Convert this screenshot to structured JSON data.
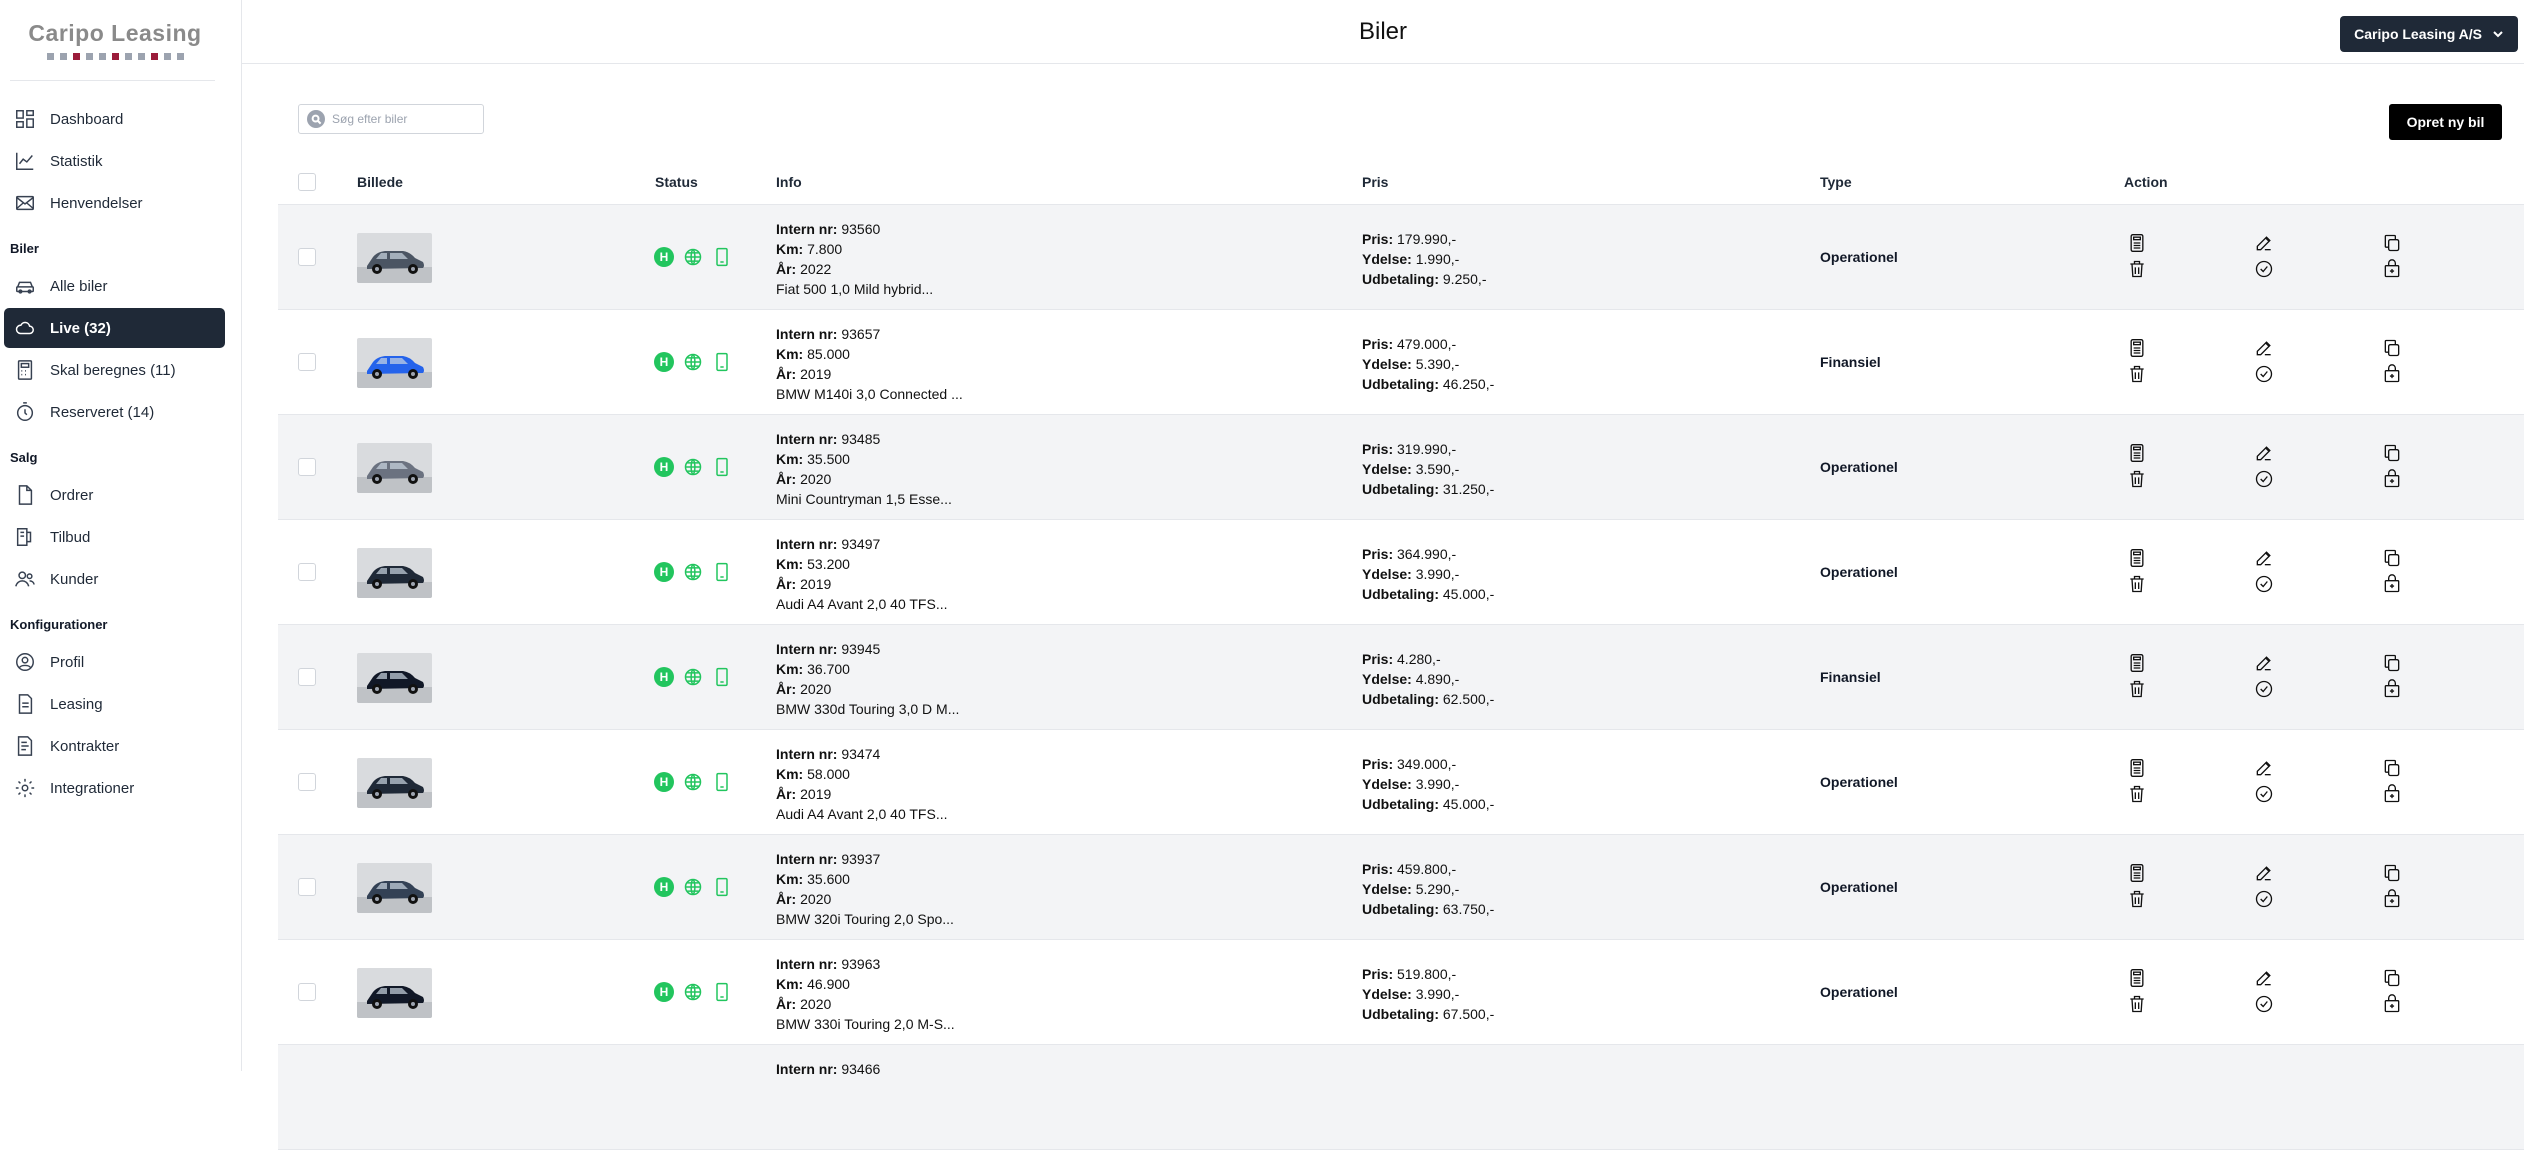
{
  "sidebar": {
    "logo": "Caripo Leasing",
    "items_main": [
      {
        "label": "Dashboard",
        "icon": "dashboard-icon"
      },
      {
        "label": "Statistik",
        "icon": "chart-icon"
      },
      {
        "label": "Henvendelser",
        "icon": "mail-icon"
      }
    ],
    "section_biler": "Biler",
    "items_biler": [
      {
        "label": "Alle biler",
        "icon": "car-icon"
      },
      {
        "label": "Live (32)",
        "icon": "cloud-icon"
      },
      {
        "label": "Skal beregnes (11)",
        "icon": "calculator-icon"
      },
      {
        "label": "Reserveret (14)",
        "icon": "timer-icon"
      }
    ],
    "section_salg": "Salg",
    "items_salg": [
      {
        "label": "Ordrer",
        "icon": "document-icon"
      },
      {
        "label": "Tilbud",
        "icon": "tag-icon"
      },
      {
        "label": "Kunder",
        "icon": "users-icon"
      }
    ],
    "section_konfig": "Konfigurationer",
    "items_konfig": [
      {
        "label": "Profil",
        "icon": "profile-icon"
      },
      {
        "label": "Leasing",
        "icon": "leasing-icon"
      },
      {
        "label": "Kontrakter",
        "icon": "contract-icon"
      },
      {
        "label": "Integrationer",
        "icon": "gear-icon"
      }
    ]
  },
  "header": {
    "title": "Biler",
    "company": "Caripo Leasing A/S"
  },
  "toolbar": {
    "search_placeholder": "Søg efter biler",
    "create_label": "Opret ny bil"
  },
  "table": {
    "headers": {
      "image": "Billede",
      "status": "Status",
      "info": "Info",
      "price": "Pris",
      "type": "Type",
      "action": "Action"
    },
    "labels": {
      "intern": "Intern nr:",
      "km": "Km:",
      "year": "År:",
      "pris": "Pris:",
      "ydelse": "Ydelse:",
      "udbetaling": "Udbetaling:"
    },
    "status_h": "H",
    "rows": [
      {
        "intern": "93560",
        "km": "7.800",
        "year": "2022",
        "model": "Fiat 500 1,0 Mild hybrid...",
        "pris": "179.990,-",
        "ydelse": "1.990,-",
        "udbetaling": "9.250,-",
        "type": "Operationel",
        "car_color": "#4b5563"
      },
      {
        "intern": "93657",
        "km": "85.000",
        "year": "2019",
        "model": "BMW M140i 3,0 Connected ...",
        "pris": "479.000,-",
        "ydelse": "5.390,-",
        "udbetaling": "46.250,-",
        "type": "Finansiel",
        "car_color": "#2563eb"
      },
      {
        "intern": "93485",
        "km": "35.500",
        "year": "2020",
        "model": "Mini Countryman 1,5 Esse...",
        "pris": "319.990,-",
        "ydelse": "3.590,-",
        "udbetaling": "31.250,-",
        "type": "Operationel",
        "car_color": "#6b7280"
      },
      {
        "intern": "93497",
        "km": "53.200",
        "year": "2019",
        "model": "Audi A4 Avant 2,0 40 TFS...",
        "pris": "364.990,-",
        "ydelse": "3.990,-",
        "udbetaling": "45.000,-",
        "type": "Operationel",
        "car_color": "#1f2937"
      },
      {
        "intern": "93945",
        "km": "36.700",
        "year": "2020",
        "model": "BMW 330d Touring 3,0 D M...",
        "pris": "4.280,-",
        "ydelse": "4.890,-",
        "udbetaling": "62.500,-",
        "type": "Finansiel",
        "car_color": "#111827"
      },
      {
        "intern": "93474",
        "km": "58.000",
        "year": "2019",
        "model": "Audi A4 Avant 2,0 40 TFS...",
        "pris": "349.000,-",
        "ydelse": "3.990,-",
        "udbetaling": "45.000,-",
        "type": "Operationel",
        "car_color": "#1f2937"
      },
      {
        "intern": "93937",
        "km": "35.600",
        "year": "2020",
        "model": "BMW 320i Touring 2,0 Spo...",
        "pris": "459.800,-",
        "ydelse": "5.290,-",
        "udbetaling": "63.750,-",
        "type": "Operationel",
        "car_color": "#334155"
      },
      {
        "intern": "93963",
        "km": "46.900",
        "year": "2020",
        "model": "BMW 330i Touring 2,0 M-S...",
        "pris": "519.800,-",
        "ydelse": "3.990,-",
        "udbetaling": "67.500,-",
        "type": "Operationel",
        "car_color": "#111827"
      }
    ],
    "partial_row": {
      "intern": "93466"
    }
  }
}
